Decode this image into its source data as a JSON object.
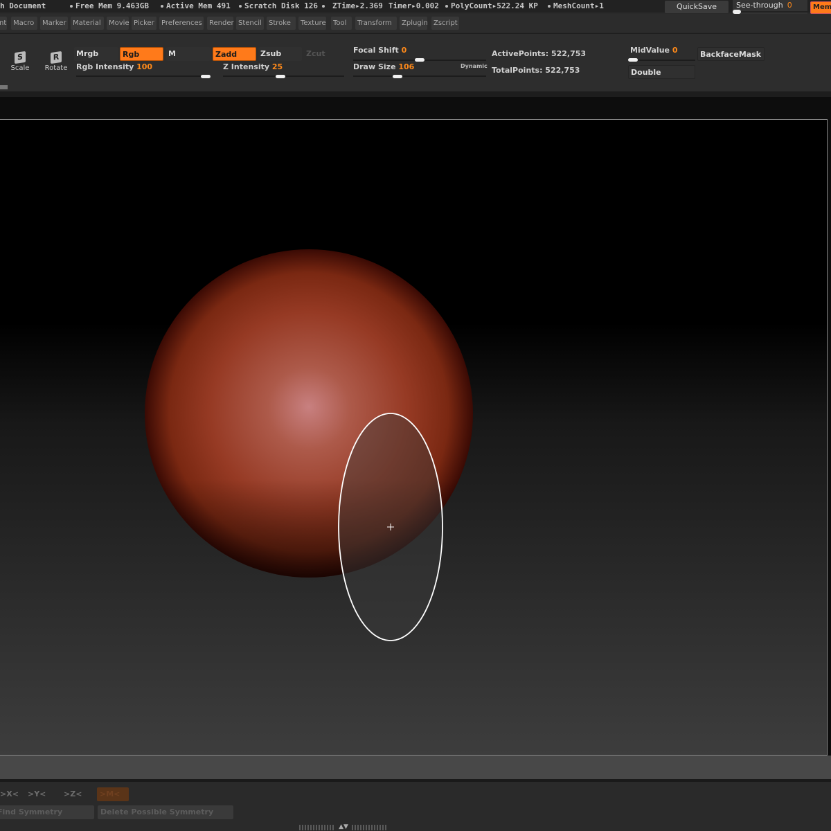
{
  "status_bar": {
    "doc_title": "h Document",
    "free_mem": "Free Mem 9.463GB",
    "active_mem": "Active Mem 491",
    "scratch_disk": "Scratch Disk 126",
    "ztime": "ZTime▸2.369",
    "timer": "Timer▸0.002",
    "polycount": "PolyCount▸522.24 KP",
    "meshcount": "MeshCount▸1",
    "quicksave": "QuickSave",
    "see_through_label": "See-through",
    "see_through_value": "0",
    "see_through_level": 0,
    "memory_button": "Memo"
  },
  "menu": [
    "nt",
    "Macro",
    "Marker",
    "Material",
    "Movie",
    "Picker",
    "Preferences",
    "Render",
    "Stencil",
    "Stroke",
    "Texture",
    "Tool",
    "Transform",
    "Zplugin",
    "Zscript"
  ],
  "shelf": {
    "scale_label": "Scale",
    "scale_glyph": "S",
    "rotate_label": "Rotate",
    "rotate_glyph": "R",
    "mrgb": "Mrgb",
    "rgb": "Rgb",
    "m": "M",
    "zadd": "Zadd",
    "zsub": "Zsub",
    "zcut": "Zcut",
    "rgb_intensity_label": "Rgb Intensity",
    "rgb_intensity_value": "100",
    "z_intensity_label": "Z Intensity",
    "z_intensity_value": "25",
    "focal_shift_label": "Focal Shift",
    "focal_shift_value": "0",
    "draw_size_label": "Draw Size",
    "draw_size_value": "106",
    "dynamic": "Dynamic",
    "active_points": "ActivePoints: 522,753",
    "total_points": "TotalPoints: 522,753",
    "midvalue_label": "MidValue",
    "midvalue_value": "0",
    "backface_mask": "BackfaceMask",
    "double": "Double"
  },
  "bottom": {
    "sym_x": ">X<",
    "sym_y": ">Y<",
    "sym_z": ">Z<",
    "sym_m": ">M<",
    "find_symmetry": "Find Symmetry",
    "delete_symmetry": "Delete Possible Symmetry"
  },
  "colors": {
    "accent": "#ff7a1a",
    "sphere_mid": "#a34128",
    "sphere_highlight": "#c88080"
  },
  "icons": {
    "cursor": "crosshair-icon",
    "collapse": "collapse-arrows-icon"
  }
}
